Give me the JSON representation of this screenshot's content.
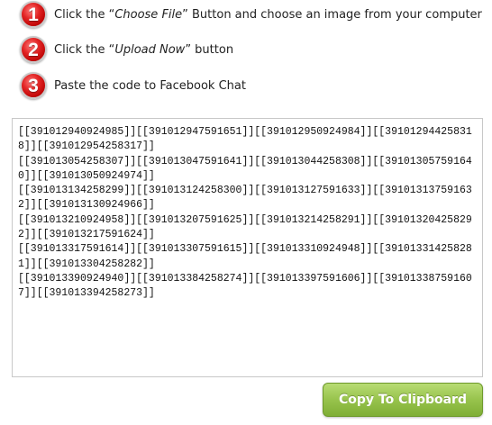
{
  "steps": [
    {
      "number": "1",
      "text_before": "Click the “",
      "emphasis": "Choose File",
      "text_after": "” Button and choose an image from your computer"
    },
    {
      "number": "2",
      "text_before": "Click the “",
      "emphasis": "Upload Now",
      "text_after": "” button"
    },
    {
      "number": "3",
      "text_before": "Paste the code to Facebook Chat",
      "emphasis": "",
      "text_after": ""
    }
  ],
  "code_box": {
    "value": "[[391012940924985]][[391012947591651]][[391012950924984]][[391012944258318]][[391012954258317]]\n[[391013054258307]][[391013047591641]][[391013044258308]][[391013057591640]][[391013050924974]]\n[[391013134258299]][[391013124258300]][[391013127591633]][[391013137591632]][[391013130924966]]\n[[391013210924958]][[391013207591625]][[391013214258291]][[391013204258292]][[391013217591624]]\n[[391013317591614]][[391013307591615]][[391013310924948]][[391013314258281]][[391013304258282]]\n[[391013390924940]][[391013384258274]][[391013397591606]][[391013387591607]][[391013394258273]]"
  },
  "copy_button": {
    "label": "Copy To Clipboard"
  },
  "colors": {
    "badge_red": "#d41414",
    "button_green": "#97c34c"
  }
}
